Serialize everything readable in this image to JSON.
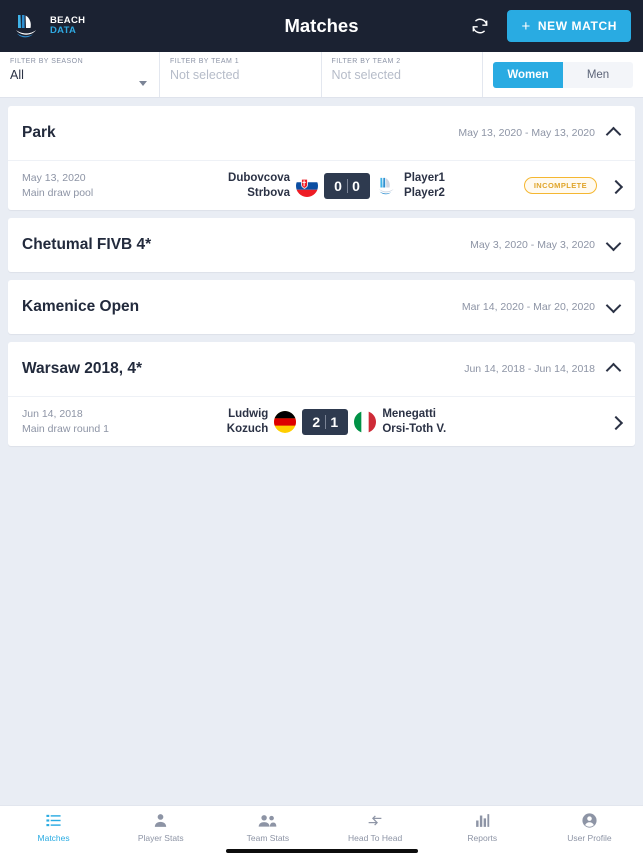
{
  "header": {
    "logo_line1": "BEACH",
    "logo_line2": "DATA",
    "logo_icon": "beach-data-sail-icon",
    "title": "Matches",
    "refresh_icon": "refresh-sync-icon",
    "new_match_label": "NEW MATCH",
    "new_match_plus": "+",
    "accent_color": "#29abe2",
    "bg_color": "#1b2232"
  },
  "filters": {
    "season": {
      "label": "FILTER BY SEASON",
      "value": "All",
      "placeholder": "All"
    },
    "team1": {
      "label": "FILTER BY TEAM 1",
      "value": "Not selected",
      "placeholder": "Not selected"
    },
    "team2": {
      "label": "FILTER BY TEAM 2",
      "value": "Not selected",
      "placeholder": "Not selected"
    },
    "gender": {
      "options": [
        "Women",
        "Men"
      ],
      "selected": "Women"
    }
  },
  "tournaments": [
    {
      "name": "Park",
      "dates": "May 13, 2020 - May 13, 2020",
      "expanded": true,
      "matches": [
        {
          "date": "May 13, 2020",
          "phase": "Main draw pool",
          "team_a": {
            "p1": "Dubovcova",
            "p2": "Strbova",
            "flag": "flag-slovakia"
          },
          "team_b": {
            "p1": "Player1",
            "p2": "Player2",
            "flag": "placeholder-beachdata-icon"
          },
          "score_a": "0",
          "score_b": "0",
          "status": "INCOMPLETE"
        }
      ]
    },
    {
      "name": "Chetumal FIVB 4*",
      "dates": "May 3, 2020 - May 3, 2020",
      "expanded": false,
      "matches": []
    },
    {
      "name": "Kamenice Open",
      "dates": "Mar 14, 2020 - Mar 20, 2020",
      "expanded": false,
      "matches": []
    },
    {
      "name": "Warsaw 2018, 4*",
      "dates": "Jun 14, 2018 - Jun 14, 2018",
      "expanded": true,
      "matches": [
        {
          "date": "Jun 14, 2018",
          "phase": "Main draw round 1",
          "team_a": {
            "p1": "Ludwig",
            "p2": "Kozuch",
            "flag": "flag-germany"
          },
          "team_b": {
            "p1": "Menegatti",
            "p2": "Orsi-Toth V.",
            "flag": "flag-italy"
          },
          "score_a": "2",
          "score_b": "1",
          "status": ""
        }
      ]
    }
  ],
  "bottom_nav": {
    "active": "Matches",
    "items": [
      {
        "label": "Matches",
        "icon": "list-icon"
      },
      {
        "label": "Player Stats",
        "icon": "person-icon"
      },
      {
        "label": "Team Stats",
        "icon": "people-icon"
      },
      {
        "label": "Head To Head",
        "icon": "compare-arrows-icon"
      },
      {
        "label": "Reports",
        "icon": "bar-chart-icon"
      },
      {
        "label": "User Profile",
        "icon": "account-circle-icon"
      }
    ]
  }
}
